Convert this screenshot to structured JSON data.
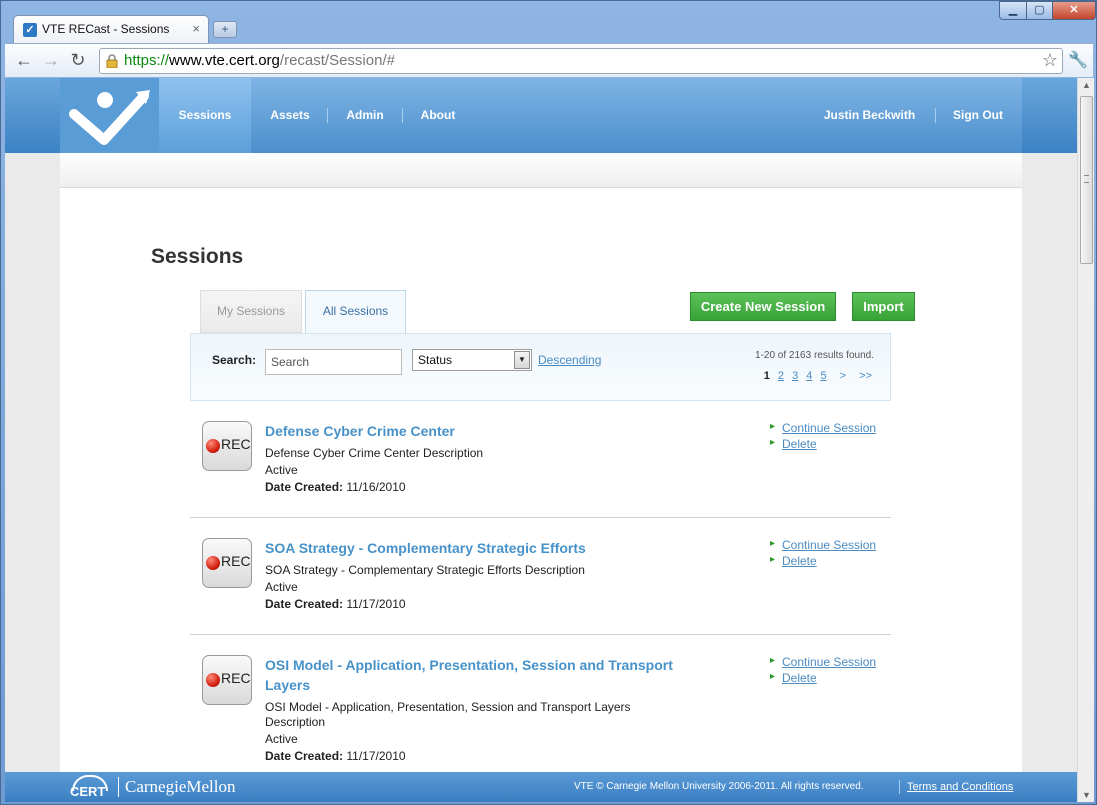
{
  "browser": {
    "tab_title": "VTE RECast - Sessions",
    "new_tab_symbol": "+",
    "close_symbol": "×",
    "url_scheme": "https://",
    "url_host": "www.vte.cert.org",
    "url_path": "/recast/Session/#"
  },
  "nav": {
    "items": [
      "Sessions",
      "Assets",
      "Admin",
      "About"
    ],
    "active": "Sessions",
    "user_name": "Justin Beckwith",
    "sign_out": "Sign Out"
  },
  "page": {
    "title": "Sessions",
    "tabs": [
      "My Sessions",
      "All Sessions"
    ],
    "active_tab": "All Sessions",
    "create_button": "Create New Session",
    "import_button": "Import"
  },
  "filters": {
    "search_label": "Search:",
    "search_placeholder": "Search",
    "status_value": "Status",
    "sort_link": "Descending",
    "results_text": "1-20 of 2163 results found.",
    "pages": [
      "1",
      "2",
      "3",
      "4",
      "5"
    ],
    "current_page": "1",
    "next": ">",
    "last": ">>"
  },
  "sessions": [
    {
      "title": "Defense Cyber Crime Center",
      "description": "Defense Cyber Crime Center Description",
      "status": "Active",
      "date_label": "Date Created:",
      "date": "11/16/2010",
      "icon_text": "REC",
      "actions": [
        "Continue Session",
        "Delete"
      ]
    },
    {
      "title": "SOA Strategy - Complementary Strategic Efforts",
      "description": "SOA Strategy - Complementary Strategic Efforts Description",
      "status": "Active",
      "date_label": "Date Created:",
      "date": "11/17/2010",
      "icon_text": "REC",
      "actions": [
        "Continue Session",
        "Delete"
      ]
    },
    {
      "title_line1": "OSI Model - Application, Presentation, Session and Transport",
      "title_line2": "Layers",
      "description_line1": "OSI Model - Application, Presentation, Session and Transport Layers",
      "description_line2": "Description",
      "status": "Active",
      "date_label": "Date Created:",
      "date": "11/17/2010",
      "icon_text": "REC",
      "actions": [
        "Continue Session",
        "Delete"
      ]
    }
  ],
  "footer": {
    "cert": "CERT",
    "university": "CarnegieMellon",
    "copyright": "VTE © Carnegie Mellon University 2006-2011. All rights reserved.",
    "terms": "Terms and Conditions"
  },
  "colors": {
    "header_blue": "#4b8fcd",
    "link_blue": "#4a8bc2",
    "title_blue": "#4792c9",
    "button_green": "#36a336"
  }
}
